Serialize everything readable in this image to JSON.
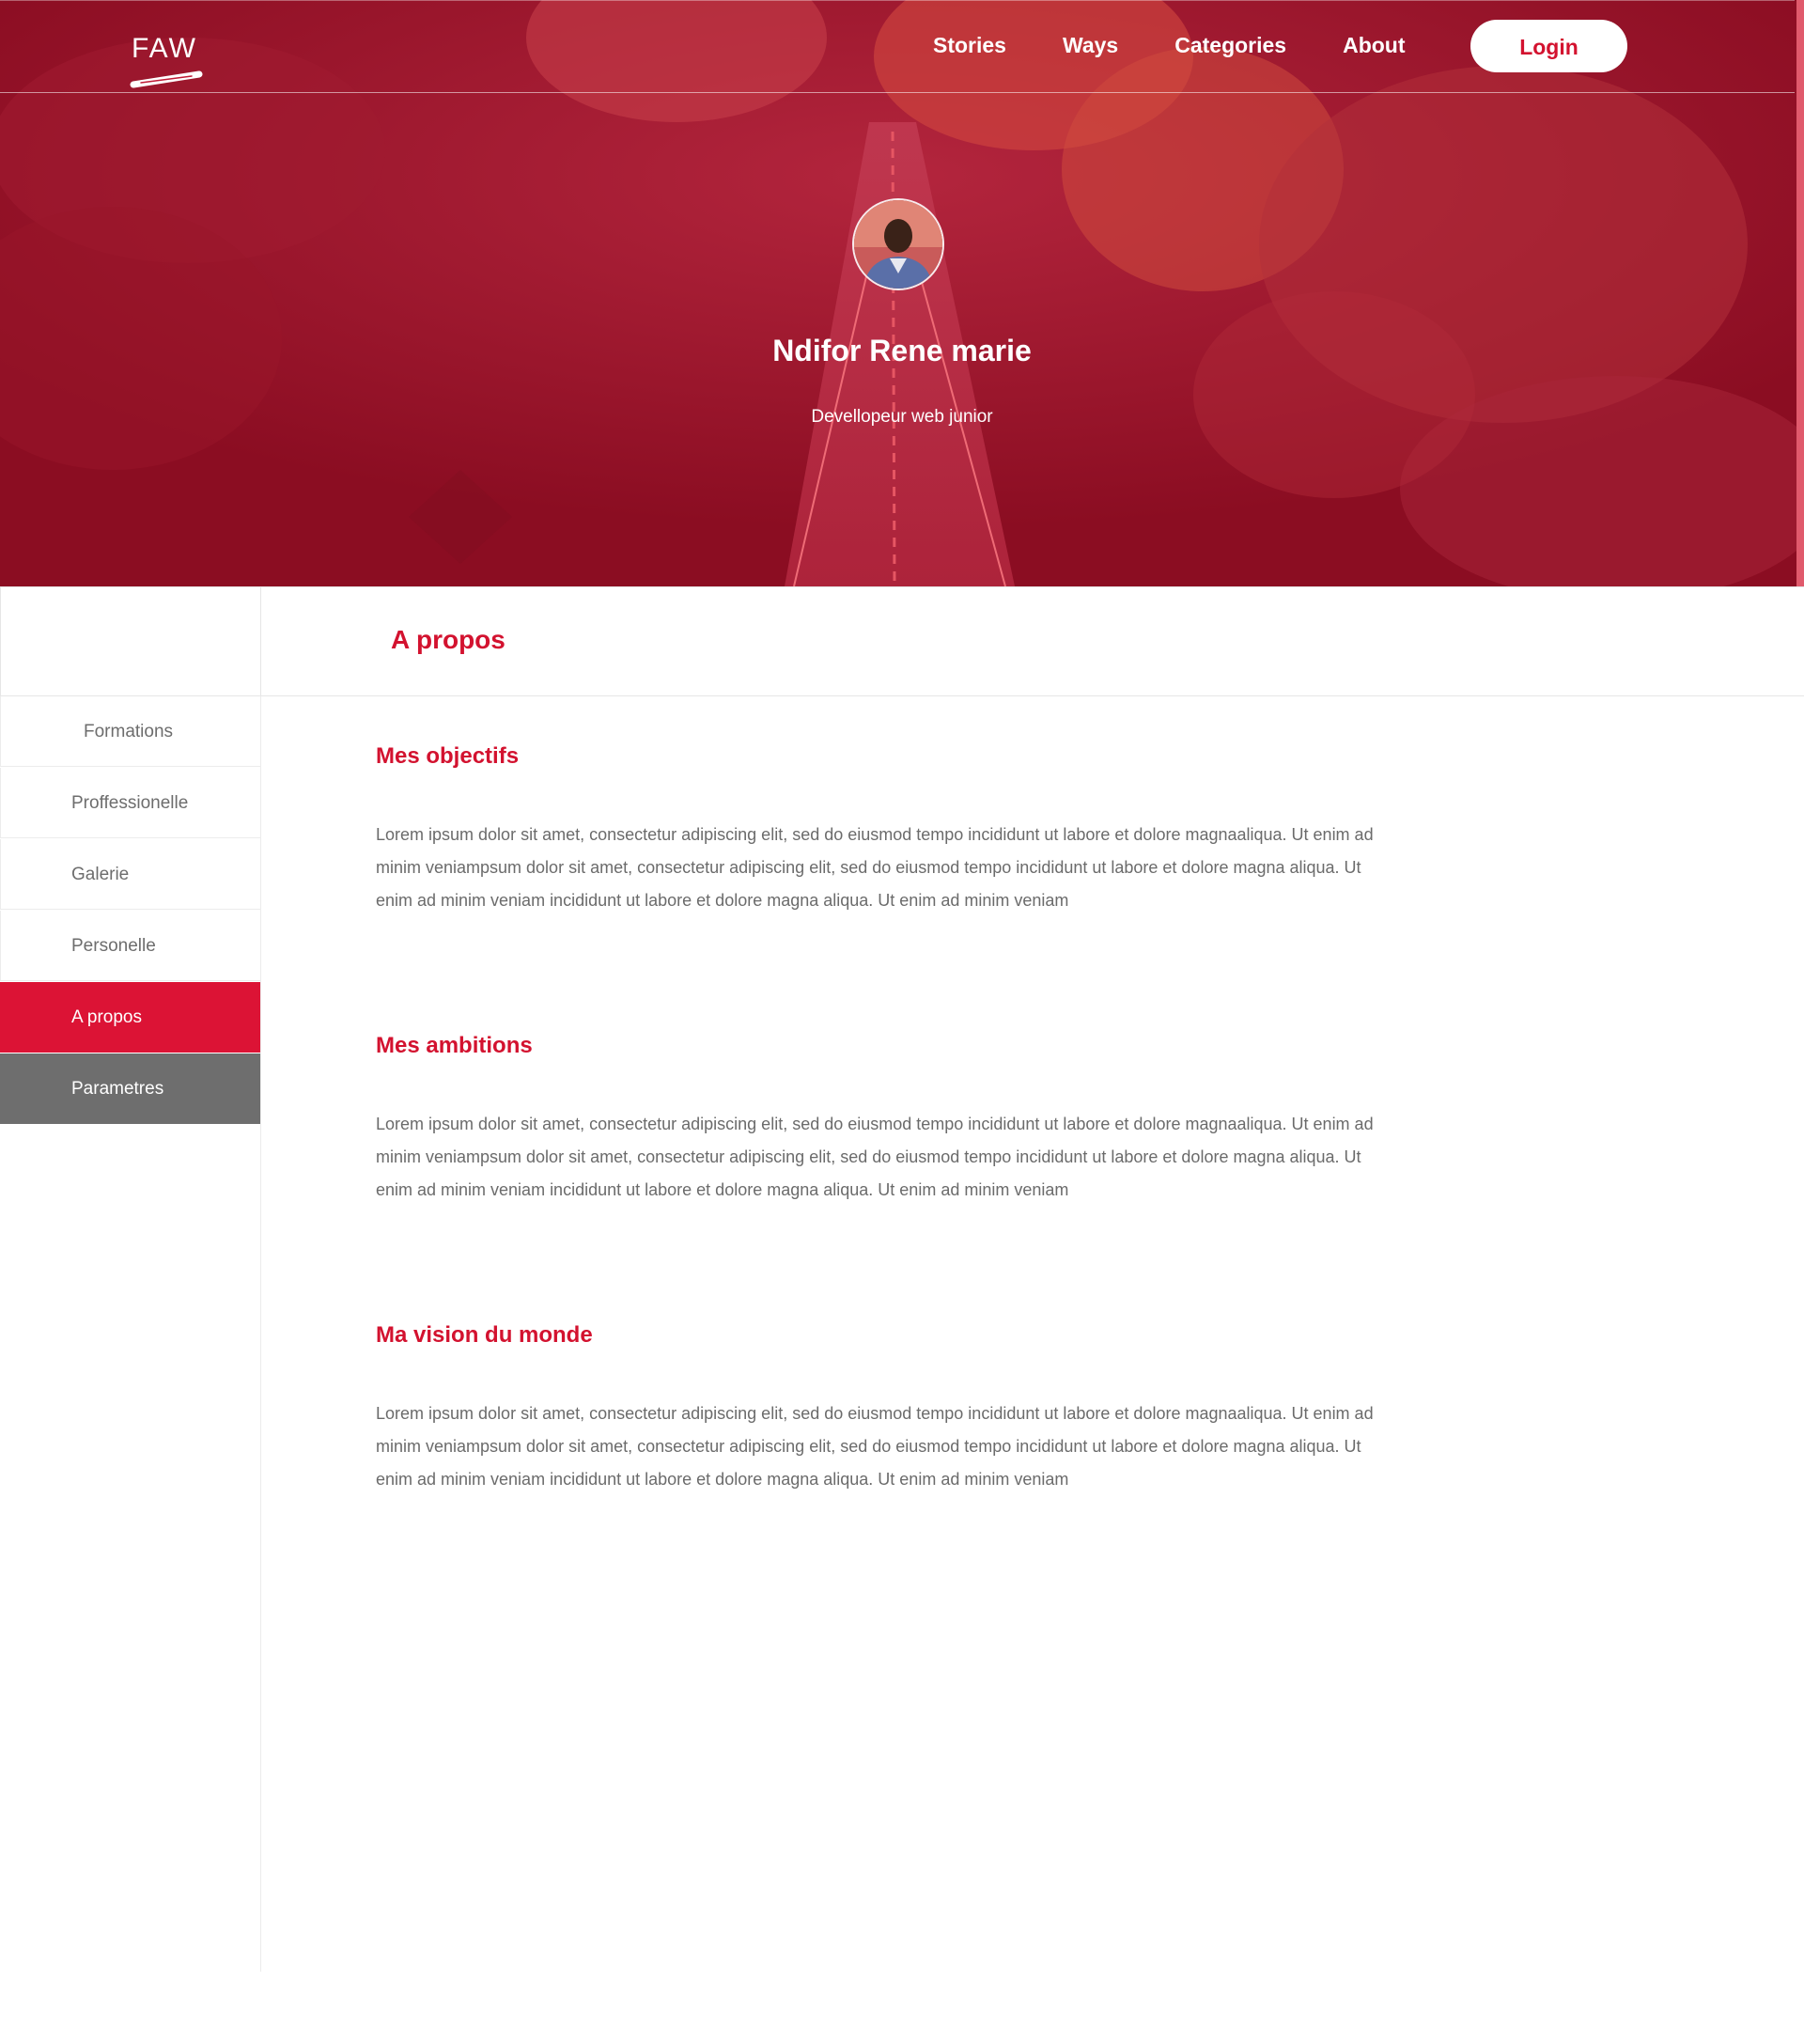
{
  "header": {
    "logo_text": "FAW",
    "nav": [
      "Stories",
      "Ways",
      "Categories",
      "About"
    ],
    "login_label": "Login"
  },
  "profile": {
    "name": "Ndifor Rene marie",
    "role": "Devellopeur web junior"
  },
  "section": {
    "title": "A propos"
  },
  "sidebar": {
    "items": [
      {
        "label": "Formations"
      },
      {
        "label": "Proffessionelle"
      },
      {
        "label": "Galerie"
      },
      {
        "label": "Personelle"
      },
      {
        "label": "A propos"
      },
      {
        "label": "Parametres"
      }
    ]
  },
  "content": {
    "blocks": [
      {
        "heading": "Mes objectifs",
        "text": "Lorem ipsum dolor sit amet, consectetur adipiscing elit, sed do eiusmod tempo incididunt ut labore et dolore magnaaliqua. Ut enim ad minim veniampsum dolor sit amet, consectetur adipiscing elit, sed do eiusmod tempo incididunt ut labore et dolore magna aliqua. Ut enim ad minim veniam incididunt ut labore et dolore magna aliqua. Ut enim ad minim veniam"
      },
      {
        "heading": "Mes ambitions",
        "text": "Lorem ipsum dolor sit amet, consectetur adipiscing elit, sed do eiusmod tempo incididunt ut labore et dolore magnaaliqua. Ut enim ad minim veniampsum dolor sit amet, consectetur adipiscing elit, sed do eiusmod tempo incididunt ut labore et dolore magna aliqua. Ut enim ad minim veniam incididunt ut labore et dolore magna aliqua. Ut enim ad minim veniam"
      },
      {
        "heading": "Ma vision du monde",
        "text": "Lorem ipsum dolor sit amet, consectetur adipiscing elit, sed do eiusmod tempo incididunt ut labore et dolore magnaaliqua. Ut enim ad minim veniampsum dolor sit amet, consectetur adipiscing elit, sed do eiusmod tempo incididunt ut labore et dolore magna aliqua. Ut enim ad minim veniam incididunt ut labore et dolore magna aliqua. Ut enim ad minim veniam"
      }
    ]
  },
  "colors": {
    "brand_red": "#d3122f",
    "active_red": "#dc1335",
    "hero_red": "#8e0f25",
    "settings_gray": "#6e6e6e",
    "text_gray": "#6b6b6b"
  },
  "icons": {
    "logo_mark": "brush-stroke-icon",
    "avatar": "user-avatar"
  }
}
